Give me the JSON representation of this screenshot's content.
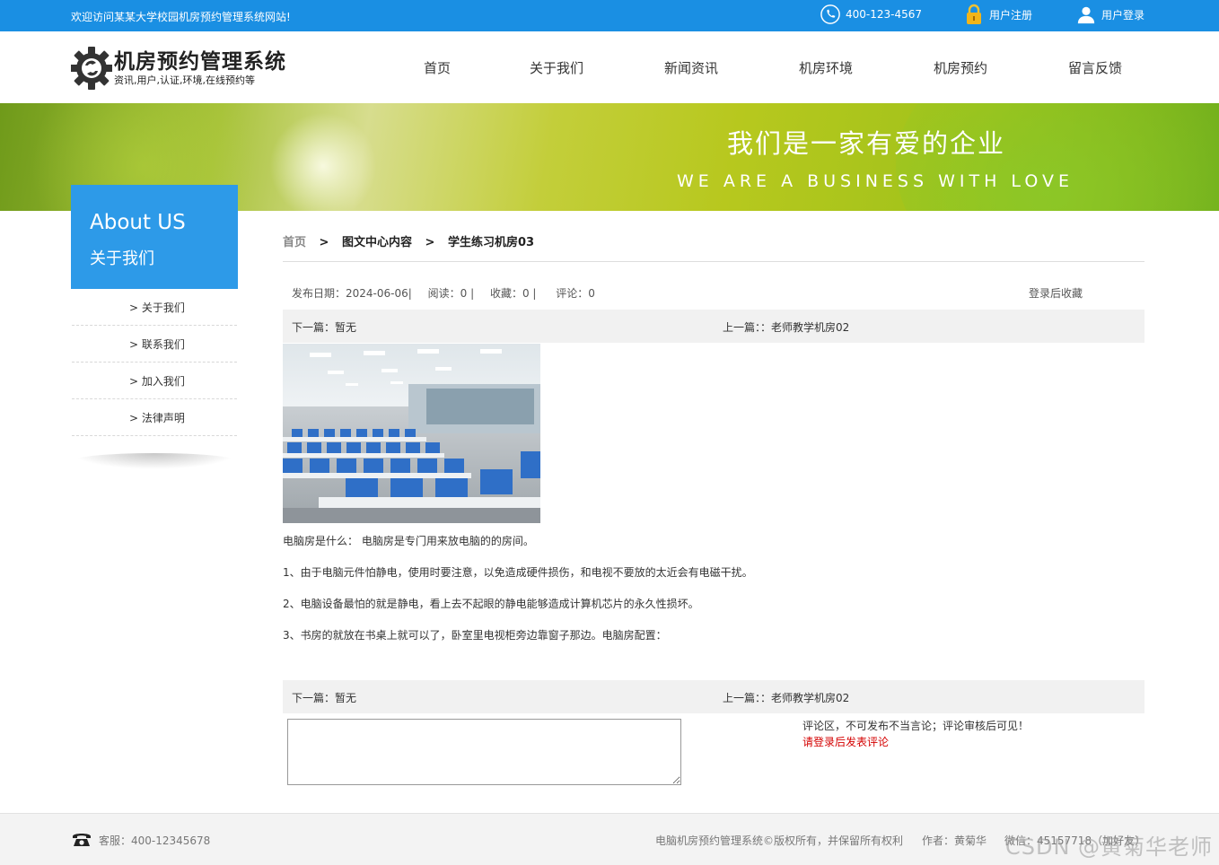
{
  "topbar": {
    "welcome": "欢迎访问某某大学校园机房预约管理系统网站!",
    "phone": "400-123-4567",
    "register": "用户注册",
    "login": "用户登录"
  },
  "logo": {
    "title": "机房预约管理系统",
    "subtitle": "资讯,用户,认证,环境,在线预约等"
  },
  "nav": [
    "首页",
    "关于我们",
    "新闻资讯",
    "机房环境",
    "机房预约",
    "留言反馈"
  ],
  "banner": {
    "slogan_cn": "我们是一家有爱的企业",
    "slogan_en": "WE ARE A BUSINESS WITH LOVE"
  },
  "sidebar": {
    "title_en": "About US",
    "title_cn": "关于我们",
    "items": [
      "> 关于我们",
      "> 联系我们",
      "> 加入我们",
      "> 法律声明"
    ]
  },
  "breadcrumb": {
    "home": "首页",
    "sep": ">",
    "category": "图文中心内容",
    "current": "学生练习机房03"
  },
  "meta": {
    "date": "发布日期：2024-06-06|",
    "views": "阅读：0 |",
    "favorites": "收藏：0 |",
    "comments": "评论：0",
    "favorite_action": "登录后收藏"
  },
  "pager": {
    "next": "下一篇：暂无",
    "prev": "上一篇：：老师教学机房02"
  },
  "article": {
    "p1": "电脑房是什么： 电脑房是专门用来放电脑的的房间。",
    "p2": "1、由于电脑元件怕静电，使用时要注意，以免造成硬件损伤，和电视不要放的太近会有电磁干扰。",
    "p3": "2、电脑设备最怕的就是静电，看上去不起眼的静电能够造成计算机芯片的永久性损坏。",
    "p4": "3、书房的就放在书桌上就可以了，卧室里电视柜旁边靠窗子那边。电脑房配置："
  },
  "comment": {
    "note": "评论区，不可发布不当言论；评论审核后可见！",
    "login_prompt": "请登录后发表评论"
  },
  "footer": {
    "service": "客服：400-12345678",
    "copyright": "电脑机房预约管理系统©版权所有，并保留所有权利",
    "author": "作者：黄菊华",
    "wechat": "微信：45157718（加好友）"
  },
  "watermark": "CSDN @黄菊华老师",
  "colors": {
    "primary": "#1a8fe3",
    "sidebar_header": "#2d9ae8",
    "login_prompt": "#d40000"
  }
}
